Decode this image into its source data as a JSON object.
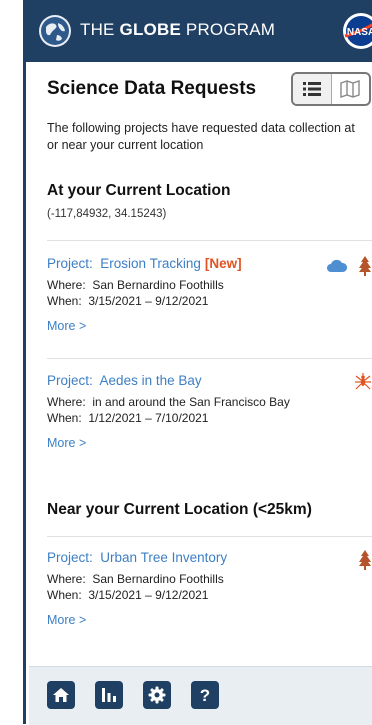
{
  "header": {
    "title_pre": "THE ",
    "title_bold": "GLOBE",
    "title_post": " PROGRAM"
  },
  "page": {
    "title": "Science Data Requests",
    "intro": "The following projects have requested data collection at or near your current location"
  },
  "current_location": {
    "heading": "At your Current Location",
    "coords": "(-117,84932, 34.15243)"
  },
  "near_location": {
    "heading": "Near your Current Location (<25km)"
  },
  "projects": [
    {
      "project_label": "Project:",
      "name": "Erosion Tracking",
      "badge": "[New]",
      "where_label": "Where:",
      "where": "San Bernardino Foothills",
      "when_label": "When:",
      "when": "3/15/2021 – 9/12/2021",
      "more": "More >",
      "icons": [
        "cloud-icon",
        "tree-icon"
      ]
    },
    {
      "project_label": "Project:",
      "name": "Aedes in the Bay",
      "where_label": "Where:",
      "where": "in and around the San Francisco Bay",
      "when_label": "When:",
      "when": "1/12/2021 – 7/10/2021",
      "more": "More >",
      "icons": [
        "mosquito-icon"
      ]
    },
    {
      "project_label": "Project:",
      "name": "Urban Tree Inventory",
      "where_label": "Where:",
      "where": "San Bernardino Foothills",
      "when_label": "When:",
      "when": "3/15/2021 – 9/12/2021",
      "more": "More >",
      "icons": [
        "tree-icon"
      ]
    }
  ],
  "bottom_nav": [
    "home-icon",
    "chart-icon",
    "settings-icon",
    "help-icon"
  ],
  "colors": {
    "header": "#1f3f63",
    "link": "#3d7fc4",
    "new_badge": "#e05423",
    "tree": "#b5542a",
    "mosquito": "#e05423",
    "cloud": "#4d8fd0"
  }
}
